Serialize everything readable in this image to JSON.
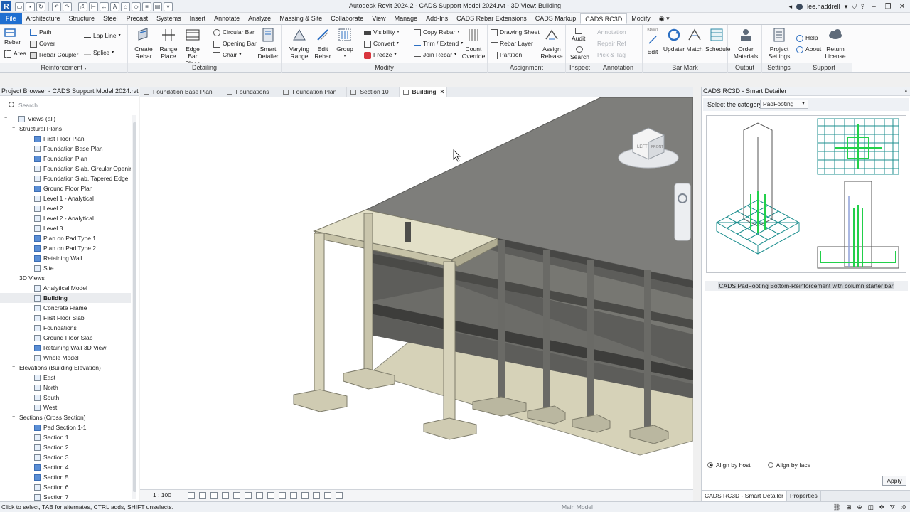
{
  "app": {
    "title": "Autodesk Revit 2024.2 - CADS Support Model 2024.rvt - 3D View: Building",
    "logo": "R",
    "user": "lee.haddrell"
  },
  "tabs": [
    "File",
    "Architecture",
    "Structure",
    "Steel",
    "Precast",
    "Systems",
    "Insert",
    "Annotate",
    "Analyze",
    "Massing & Site",
    "Collaborate",
    "View",
    "Manage",
    "Add-Ins",
    "CADS Rebar Extensions",
    "CADS Markup",
    "CADS RC3D",
    "Modify"
  ],
  "active_tab": "CADS RC3D",
  "ribbon": {
    "reinforcement": {
      "title": "Reinforcement",
      "rebar": "Rebar",
      "area": "Area",
      "path": "Path",
      "cover": "Cover",
      "rebar_coupler": "Rebar Coupler",
      "lap_line": "Lap Line",
      "splice": "Splice"
    },
    "detailing": {
      "title": "Detailing",
      "create_rebar": [
        "Create",
        "Rebar"
      ],
      "range_place": [
        "Range",
        "Place"
      ],
      "edge_bar_place": [
        "Edge Bar",
        "Place"
      ],
      "circular_bar": "Circular Bar",
      "opening_bar": "Opening Bar",
      "chair": "Chair",
      "smart_detailer": [
        "Smart",
        "Detailer"
      ]
    },
    "modify": {
      "title": "Modify",
      "varying_range": [
        "Varying",
        "Range"
      ],
      "edit_rebar": [
        "Edit",
        "Rebar"
      ],
      "group": "Group",
      "visibility": "Visibility",
      "convert": "Convert",
      "freeze": "Freeze",
      "copy_rebar": "Copy Rebar",
      "trim_extend": "Trim / Extend",
      "join_rebar": "Join Rebar"
    },
    "assignment": {
      "title": "Assignment",
      "count_override": [
        "Count",
        "Override"
      ],
      "drawing_sheet": "Drawing Sheet",
      "rebar_layer": "Rebar Layer",
      "partition": "Partition",
      "assign_release": [
        "Assign",
        "Release"
      ]
    },
    "inspect": {
      "title": "Inspect",
      "audit": "Audit",
      "search": "Search"
    },
    "annotation": {
      "title": "Annotation",
      "annotation": "Annotation",
      "repair_ref": "Repair Ref",
      "pick_tag": "Pick & Tag"
    },
    "bar_mark": {
      "title": "Bar Mark",
      "edit": "Edit",
      "updater": "Updater",
      "match": "Match",
      "bm_code": "BR001"
    },
    "output": {
      "title": "Output",
      "schedule": "Schedule",
      "order_materials": [
        "Order",
        "Materials"
      ]
    },
    "settings": {
      "title": "Settings",
      "project_settings": [
        "Project",
        "Settings"
      ]
    },
    "support": {
      "title": "Support",
      "help": "Help",
      "about": "About",
      "return_license": [
        "Return",
        "License"
      ]
    }
  },
  "project_browser": {
    "title": "Project Browser - CADS Support Model 2024.rvt",
    "search_placeholder": "Search",
    "nodes": [
      {
        "label": "Views (all)",
        "level": 0,
        "type": "root",
        "exp": "−"
      },
      {
        "label": "Structural Plans",
        "level": 1,
        "type": "group",
        "exp": "−"
      },
      {
        "label": "First Floor Plan",
        "level": 2,
        "type": "view",
        "blue": true
      },
      {
        "label": "Foundation Base Plan",
        "level": 2,
        "type": "view"
      },
      {
        "label": "Foundation Plan",
        "level": 2,
        "type": "view",
        "blue": true
      },
      {
        "label": "Foundation Slab, Circular Opening",
        "level": 2,
        "type": "view"
      },
      {
        "label": "Foundation Slab, Tapered Edge",
        "level": 2,
        "type": "view"
      },
      {
        "label": "Ground Floor Plan",
        "level": 2,
        "type": "view",
        "blue": true
      },
      {
        "label": "Level 1 - Analytical",
        "level": 2,
        "type": "view"
      },
      {
        "label": "Level 2",
        "level": 2,
        "type": "view"
      },
      {
        "label": "Level 2 - Analytical",
        "level": 2,
        "type": "view"
      },
      {
        "label": "Level 3",
        "level": 2,
        "type": "view"
      },
      {
        "label": "Plan on Pad Type 1",
        "level": 2,
        "type": "view",
        "blue": true
      },
      {
        "label": "Plan on Pad Type 2",
        "level": 2,
        "type": "view",
        "blue": true
      },
      {
        "label": "Retaining Wall",
        "level": 2,
        "type": "view",
        "blue": true
      },
      {
        "label": "Site",
        "level": 2,
        "type": "view"
      },
      {
        "label": "3D Views",
        "level": 1,
        "type": "group",
        "exp": "−"
      },
      {
        "label": "Analytical Model",
        "level": 2,
        "type": "view"
      },
      {
        "label": "Building",
        "level": 2,
        "type": "view",
        "selected": true
      },
      {
        "label": "Concrete Frame",
        "level": 2,
        "type": "view"
      },
      {
        "label": "First Floor Slab",
        "level": 2,
        "type": "view"
      },
      {
        "label": "Foundations",
        "level": 2,
        "type": "view"
      },
      {
        "label": "Ground Floor Slab",
        "level": 2,
        "type": "view"
      },
      {
        "label": "Retaining Wall 3D View",
        "level": 2,
        "type": "view",
        "blue": true
      },
      {
        "label": "Whole Model",
        "level": 2,
        "type": "view"
      },
      {
        "label": "Elevations (Building Elevation)",
        "level": 1,
        "type": "group",
        "exp": "−"
      },
      {
        "label": "East",
        "level": 2,
        "type": "view"
      },
      {
        "label": "North",
        "level": 2,
        "type": "view"
      },
      {
        "label": "South",
        "level": 2,
        "type": "view"
      },
      {
        "label": "West",
        "level": 2,
        "type": "view"
      },
      {
        "label": "Sections (Cross Section)",
        "level": 1,
        "type": "group",
        "exp": "−"
      },
      {
        "label": "Pad Section 1-1",
        "level": 2,
        "type": "view",
        "blue": true
      },
      {
        "label": "Section 1",
        "level": 2,
        "type": "view"
      },
      {
        "label": "Section 2",
        "level": 2,
        "type": "view"
      },
      {
        "label": "Section 3",
        "level": 2,
        "type": "view"
      },
      {
        "label": "Section 4",
        "level": 2,
        "type": "view",
        "blue": true
      },
      {
        "label": "Section 5",
        "level": 2,
        "type": "view",
        "blue": true
      },
      {
        "label": "Section 6",
        "level": 2,
        "type": "view"
      },
      {
        "label": "Section 7",
        "level": 2,
        "type": "view"
      }
    ]
  },
  "view_tabs": [
    {
      "label": "Foundation Base Plan",
      "active": false
    },
    {
      "label": "Foundations",
      "active": false
    },
    {
      "label": "Foundation Plan",
      "active": false
    },
    {
      "label": "Section 10",
      "active": false
    },
    {
      "label": "Building",
      "active": true,
      "close": "×"
    }
  ],
  "view": {
    "scale": "1 : 100",
    "viewcube_left": "LEFT",
    "viewcube_front": "FRONT"
  },
  "smart_detailer": {
    "title": "CADS RC3D - Smart Detailer",
    "close": "×",
    "category_label": "Select the category:",
    "category_value": "PadFooting",
    "description": "CADS PadFooting Bottom-Reinforcement with column starter bar",
    "option_host": "Align by host",
    "option_face": "Align by face",
    "apply": "Apply",
    "bottom_tabs": [
      "CADS RC3D - Smart Detailer",
      "Properties"
    ]
  },
  "status": {
    "hint": "Click to select, TAB for alternates, CTRL adds, SHIFT unselects.",
    "model": "Main Model",
    "zero1": ":0",
    "zero2": ":0"
  },
  "colors": {
    "accent": "#1f6fd1",
    "rebar_green": "#22d04a",
    "grid_teal": "#1d8f8f",
    "slab": "#7d7d7a"
  }
}
